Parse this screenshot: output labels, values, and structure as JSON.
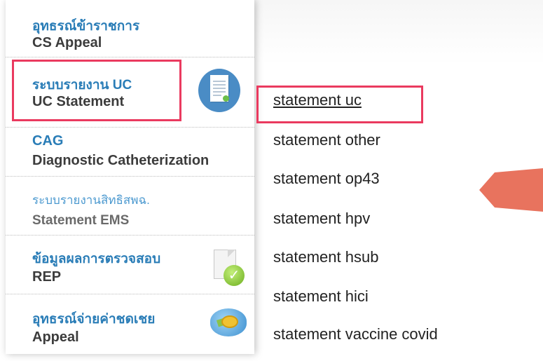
{
  "menu": {
    "items": [
      {
        "thai": "อุทธรณ์ข้าราชการ",
        "eng": "CS Appeal"
      },
      {
        "thai": "ระบบรายงาน UC",
        "eng": "UC Statement",
        "icon": "document-icon"
      },
      {
        "thai": "CAG",
        "eng": "Diagnostic Catheterization"
      },
      {
        "thai": "ระบบรายงานสิทธิสพฉ.",
        "eng": "Statement EMS"
      },
      {
        "thai": "ข้อมูลผลการตรวจสอบ",
        "eng": "REP",
        "icon": "checked-document-icon"
      },
      {
        "thai": "อุทธรณ์จ่ายค่าชดเชย",
        "eng": "Appeal",
        "icon": "money-bubble-icon"
      }
    ]
  },
  "submenu": {
    "items": [
      "statement uc",
      "statement other",
      "statement op43",
      "statement hpv",
      "statement hsub",
      "statement hici",
      "statement vaccine covid"
    ]
  },
  "colors": {
    "highlight": "#ea3a5f",
    "menu_thai": "#2a7db7",
    "arrow": "#e8735e"
  }
}
